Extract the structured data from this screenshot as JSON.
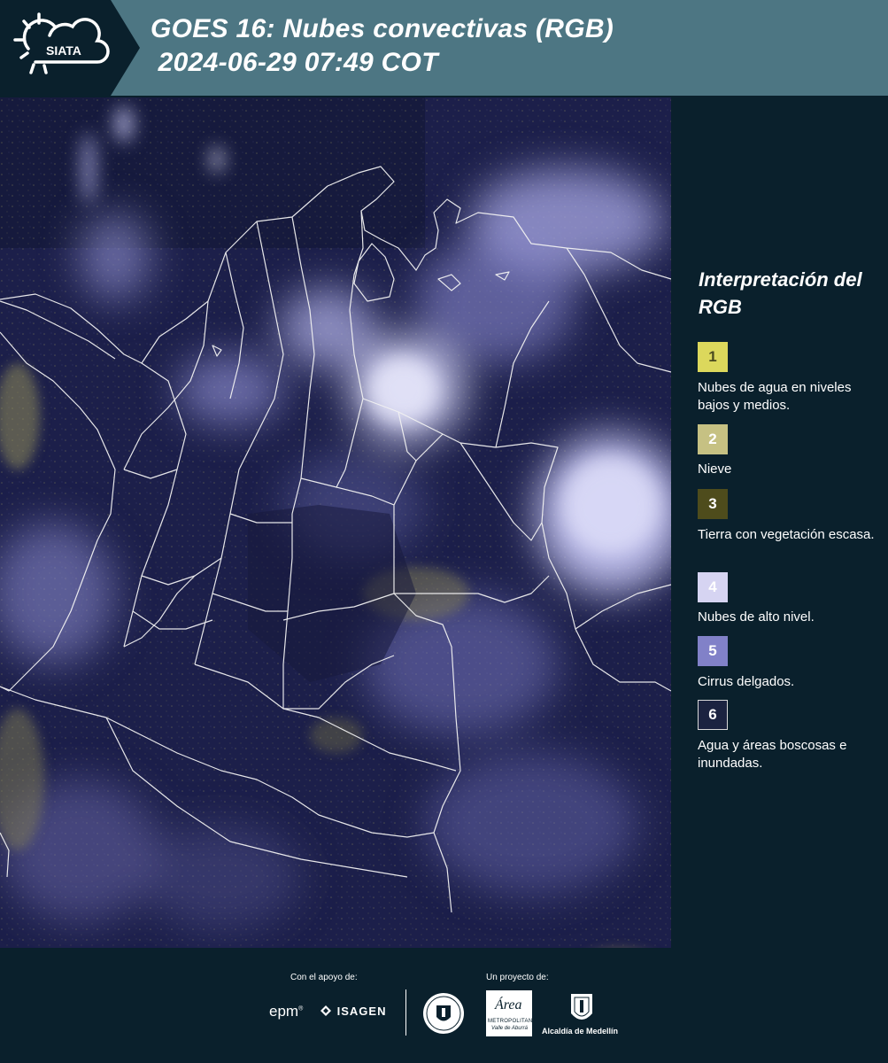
{
  "header": {
    "logo_text": "SIATA",
    "title_line1": "GOES 16: Nubes convectivas (RGB)",
    "title_line2": " 2024-06-29 07:49 COT"
  },
  "colors": {
    "header_bg": "#4d7683",
    "logo_bg": "#0a202c",
    "panel_bg": "#0a202c",
    "map_base": "#1c1f4a"
  },
  "legend": {
    "title": "Interpretación del RGB",
    "items": [
      {
        "number": "1",
        "label": "Nubes de agua en niveles bajos y medios.",
        "color": "#dcd85c",
        "text_color": "#4a4a20"
      },
      {
        "number": "2",
        "label": "Nieve",
        "color": "#c6c183",
        "text_color": "#ffffff"
      },
      {
        "number": "3",
        "label": "Tierra con vegetación escasa.",
        "color": "#4e4c1c",
        "text_color": "#ffffff"
      },
      {
        "number": "4",
        "label": "Nubes de alto nivel.",
        "color": "#d6d4f2",
        "text_color": "#ffffff"
      },
      {
        "number": "5",
        "label": "Cirrus delgados.",
        "color": "#8181c8",
        "text_color": "#ffffff"
      },
      {
        "number": "6",
        "label": "Agua y áreas boscosas e inundadas.",
        "color": "#1b2340",
        "text_color": "#ffffff"
      }
    ]
  },
  "footer": {
    "support_label": "Con el apoyo de:",
    "project_label": "Un proyecto de:",
    "sponsor_epm": "epm",
    "sponsor_isagen": "ISAGEN",
    "area_logo_text": "Área",
    "area_subtext": "METROPOLITANA",
    "area_subtext2": "Valle de Aburrá",
    "alcaldia": "Alcaldía de Medellín"
  },
  "icons": [
    "siata-cloud-sun-logo",
    "isagen-mark-icon",
    "medellin-seal",
    "alcaldia-shield"
  ]
}
